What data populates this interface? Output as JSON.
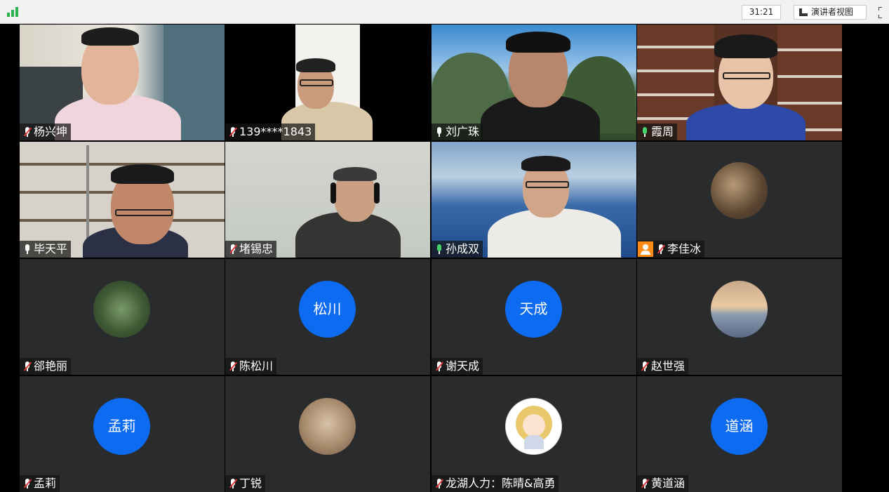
{
  "toolbar": {
    "signal_icon": "signal-bars-icon",
    "timer": "31:21",
    "presenter_view_label": "演讲者视图",
    "fullscreen_icon": "fullscreen-icon",
    "accent_color": "#2bb24c"
  },
  "participants": [
    {
      "name": "杨兴坤",
      "mic": "muted",
      "video": true
    },
    {
      "name": "139****1843",
      "mic": "muted",
      "video": true
    },
    {
      "name": "刘广珠",
      "mic": "on",
      "video": true
    },
    {
      "name": "霞周",
      "mic": "on-green",
      "video": true
    },
    {
      "name": "毕天平",
      "mic": "on",
      "video": true
    },
    {
      "name": "堵锡忠",
      "mic": "muted",
      "video": true
    },
    {
      "name": "孙成双",
      "mic": "on-green",
      "video": true,
      "speaking": true
    },
    {
      "name": "李佳冰",
      "mic": "muted",
      "video": false,
      "host": true,
      "avatar": "photo"
    },
    {
      "name": "郤艳丽",
      "mic": "muted",
      "video": false,
      "avatar": "photo"
    },
    {
      "name": "陈松川",
      "mic": "muted",
      "video": false,
      "avatar_text": "松川"
    },
    {
      "name": "谢天成",
      "mic": "muted",
      "video": false,
      "avatar_text": "天成"
    },
    {
      "name": "赵世强",
      "mic": "muted",
      "video": false,
      "avatar": "photo"
    },
    {
      "name": "孟莉",
      "mic": "muted",
      "video": false,
      "avatar_text": "孟莉"
    },
    {
      "name": "丁锐",
      "mic": "muted",
      "video": false,
      "avatar": "photo"
    },
    {
      "name": "龙湖人力：陈晴&高勇",
      "mic": "muted",
      "video": false,
      "avatar": "cartoon"
    },
    {
      "name": "黄道涵",
      "mic": "muted",
      "video": false,
      "avatar_text": "道涵"
    }
  ]
}
